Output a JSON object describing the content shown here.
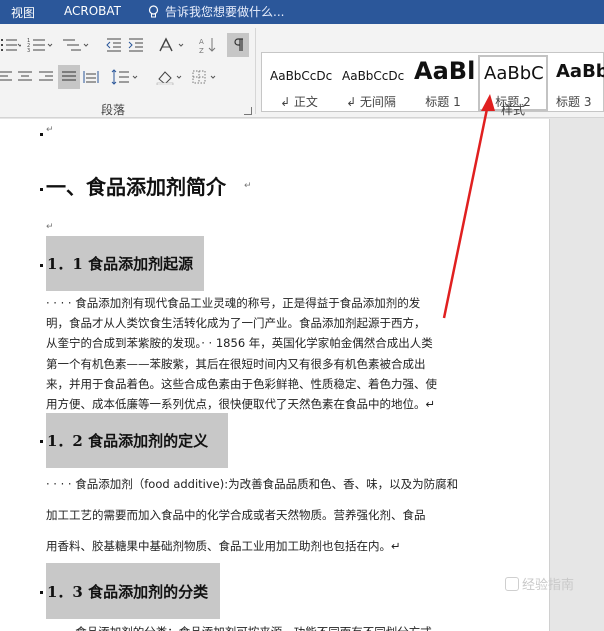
{
  "tabs": {
    "view": "视图",
    "acrobat": "ACROBAT"
  },
  "tellme": {
    "placeholder": "告诉我您想要做什么..."
  },
  "ribbon": {
    "paragraph_group": "段落",
    "styles_group": "样式",
    "styles": [
      {
        "sample": "AaBbCcDc",
        "name": "↲ 正文"
      },
      {
        "sample": "AaBbCcDc",
        "name": "↲ 无间隔"
      },
      {
        "sample": "AaBl",
        "name": "标题 1"
      },
      {
        "sample": "AaBbC",
        "name": "标题 2"
      },
      {
        "sample": "AaBb",
        "name": "标题 3"
      }
    ]
  },
  "document": {
    "heading1": "一、食品添加剂简介",
    "sections": [
      {
        "heading": "1．1 食品添加剂起源",
        "lines": [
          "· · · · 食品添加剂有现代食品工业灵魂的称号，正是得益于食品添加剂的发",
          "明，食品才从人类饮食生活转化成为了一门产业。食品添加剂起源于西方，",
          "从奎宁的合成到苯紫胺的发现。· · 1856 年，英国化学家帕金偶然合成出人类",
          "第一个有机色素——苯胺紫，其后在很短时间内又有很多有机色素被合成出",
          "来，并用于食品着色。这些合成色素由于色彩鲜艳、性质稳定、着色力强、使",
          "用方便、成本低廉等一系列优点，很快便取代了天然色素在食品中的地位。↵"
        ]
      },
      {
        "heading": "1．2 食品添加剂的定义",
        "lines": [
          "· · · · 食品添加剂（food additive):为改善食品品质和色、香、味，以及为防腐和",
          "加工工艺的需要而加入食品中的化学合成或者天然物质。营养强化剂、食品",
          "用香料、胶基糖果中基础剂物质、食品工业用加工助剂也包括在内。↵"
        ]
      },
      {
        "heading": "1．3 食品添加剂的分类",
        "lines": [
          "· · · · 食品添加剂的分类：食品添加剂可按来源、功能不同而有不同划分方式。"
        ]
      }
    ]
  },
  "watermark": {
    "text": "经验指南"
  },
  "colors": {
    "titlebar": "#2b579a",
    "arrow": "#e02020",
    "heading_bg": "#c8c8c8"
  }
}
